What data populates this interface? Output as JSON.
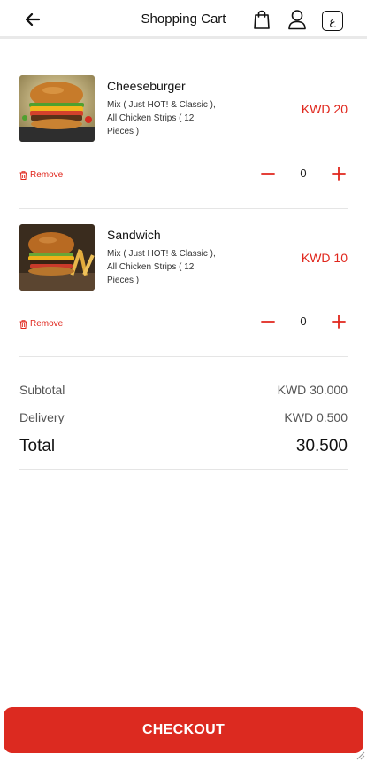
{
  "header": {
    "title": "Shopping Cart",
    "lang_label": "ع"
  },
  "cart": {
    "items": [
      {
        "name": "Cheeseburger",
        "description": "Mix ( Just HOT! & Classic ), All Chicken Strips ( 12 Pieces )",
        "price": "KWD 20",
        "remove_label": "Remove",
        "quantity": "0"
      },
      {
        "name": "Sandwich",
        "description": "Mix ( Just HOT! & Classic ), All Chicken Strips ( 12 Pieces )",
        "price": "KWD 10",
        "remove_label": "Remove",
        "quantity": "0"
      }
    ]
  },
  "summary": {
    "subtotal_label": "Subtotal",
    "subtotal_value": "KWD 30.000",
    "delivery_label": "Delivery",
    "delivery_value": "KWD 0.500",
    "total_label": "Total",
    "total_value": "30.500"
  },
  "checkout_label": "CHECKOUT",
  "colors": {
    "accent": "#dc2a20",
    "price": "#e0261c"
  },
  "icons": [
    "back-arrow-icon",
    "shopping-bag-icon",
    "user-icon",
    "trash-icon",
    "minus-icon",
    "plus-icon"
  ]
}
